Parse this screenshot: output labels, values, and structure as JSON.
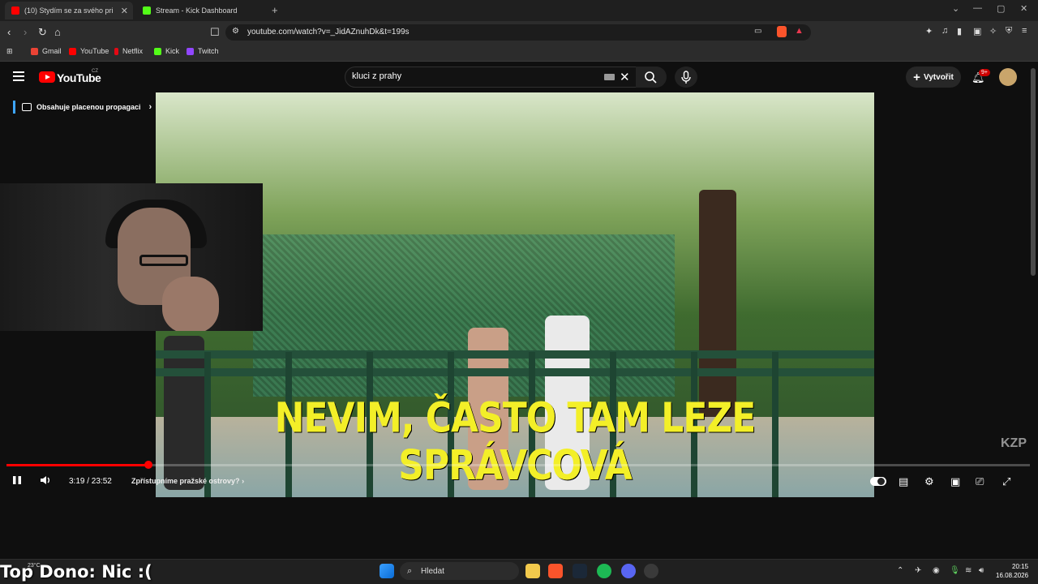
{
  "browser": {
    "tabs": [
      {
        "label": "(10) Stydím se za svého prim…",
        "active": true
      },
      {
        "label": "Stream - Kick Dashboard",
        "active": false
      }
    ],
    "url": "youtube.com/watch?v=_JidAZnuhDk&t=199s",
    "bookmarks": [
      "Gmail",
      "YouTube",
      "Netflix",
      "Kick",
      "Twitch"
    ]
  },
  "youtube": {
    "logo_text": "YouTube",
    "region": "CZ",
    "search_query": "kluci z prahy",
    "create_label": "Vytvořit",
    "notification_badge": "9+",
    "promo_label": "Obsahuje placenou propagaci"
  },
  "video": {
    "subtitle": "NEVIM, ČASTO TAM LEZE SPRÁVCOVÁ",
    "watermark": "KZP",
    "current_time": "3:19",
    "duration": "23:52",
    "time_display": "3:19 / 23:52",
    "chapter": "Zpřístupníme pražské ostrovy?",
    "progress_fraction": 0.139
  },
  "overlay": {
    "top_dono": "Top Dono: Nic :("
  },
  "taskbar": {
    "search_placeholder": "Hledat",
    "weather": "23°C",
    "time": "20:15",
    "date": "16.08.2026"
  },
  "colors": {
    "youtube_red": "#ff0000",
    "subtitle_yellow": "#f3ef28",
    "kick_green": "#53fc18",
    "twitch_purple": "#9146ff"
  }
}
